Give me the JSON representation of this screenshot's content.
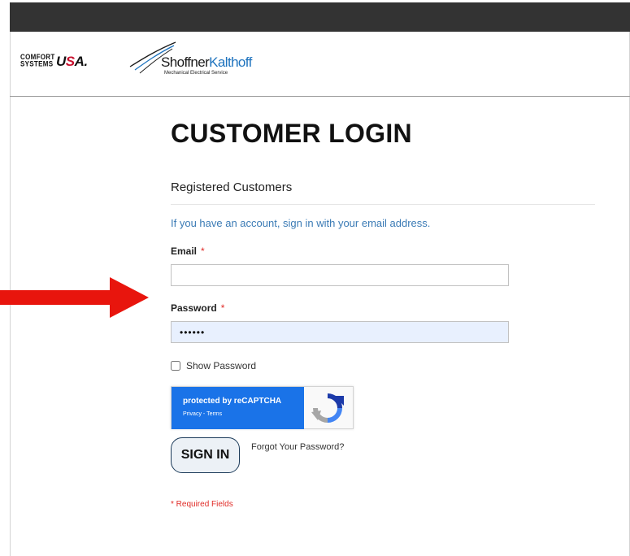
{
  "header": {
    "logo_csusa": {
      "small_line1": "COMFORT",
      "small_line2": "SYSTEMS",
      "big_prefix": "U",
      "big_accent": "S",
      "big_suffix": "A",
      "mark": "."
    },
    "logo_sk": {
      "name_part1": "Shoffner",
      "name_part2": "Kalthoff",
      "subtitle": "Mechanical Electrical Service"
    }
  },
  "page": {
    "title": "CUSTOMER LOGIN",
    "section_title": "Registered Customers",
    "intro": "If you have an account, sign in with your email address."
  },
  "form": {
    "email": {
      "label": "Email",
      "required_mark": "*",
      "value": "",
      "placeholder": ""
    },
    "password": {
      "label": "Password",
      "required_mark": "*",
      "value": "••••••"
    },
    "show_password": {
      "label": "Show Password",
      "checked": false
    },
    "recaptcha": {
      "protected_prefix": "protected by ",
      "brand": "reCAPTCHA",
      "privacy": "Privacy",
      "separator": " - ",
      "terms": "Terms"
    },
    "signin_label": "SIGN IN",
    "forgot_label": "Forgot Your Password?",
    "required_note": "* Required Fields"
  },
  "colors": {
    "accent_red": "#e02b27",
    "arrow_red": "#e8150d",
    "link_blue": "#3b7bb5",
    "topbar": "#333333",
    "recaptcha_blue": "#1a73e8"
  },
  "icons": [
    "red-arrow-icon",
    "recaptcha-logo-icon",
    "swoosh-icon"
  ]
}
